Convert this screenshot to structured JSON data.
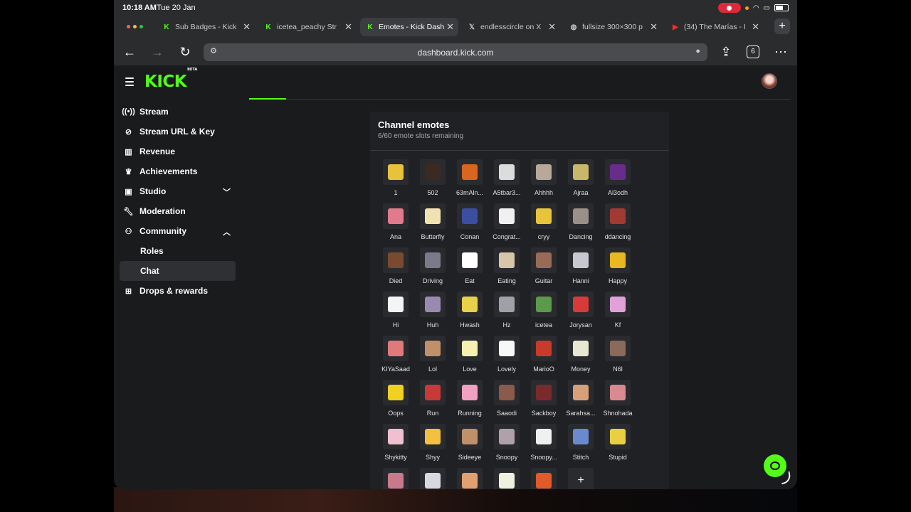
{
  "status": {
    "time": "10:18 AM",
    "date": "Tue 20 Jan"
  },
  "tabs": [
    {
      "label": "Sub Badges - Kick",
      "icon": "kick-icon"
    },
    {
      "label": "icetea_peachy Str",
      "icon": "kick-icon"
    },
    {
      "label": "Emotes - Kick Dash",
      "icon": "kick-icon",
      "active": true
    },
    {
      "label": "endlesscircle on X",
      "icon": "x-icon"
    },
    {
      "label": "fullsize 300×300 p",
      "icon": "globe-icon"
    },
    {
      "label": "(34) The Marías - I",
      "icon": "youtube-icon"
    }
  ],
  "browser": {
    "url": "dashboard.kick.com",
    "tab_count": "6"
  },
  "app": {
    "logo": "KICK",
    "logo_badge": "BETA"
  },
  "sidebar": [
    {
      "label": "Stream",
      "icon": "broadcast-icon"
    },
    {
      "label": "Stream URL & Key",
      "icon": "link-icon"
    },
    {
      "label": "Revenue",
      "icon": "chart-icon"
    },
    {
      "label": "Achievements",
      "icon": "trophy-icon"
    },
    {
      "label": "Studio",
      "icon": "studio-icon",
      "chevron": "down"
    },
    {
      "label": "Moderation",
      "icon": "wrench-icon"
    },
    {
      "label": "Community",
      "icon": "community-icon",
      "chevron": "up"
    },
    {
      "label": "Roles",
      "sub": true
    },
    {
      "label": "Chat",
      "sub": true,
      "active": true
    },
    {
      "label": "Drops & rewards",
      "icon": "drops-icon"
    }
  ],
  "panel": {
    "title": "Channel emotes",
    "subtitle": "6/60 emote slots remaining",
    "emotes": [
      {
        "name": "1",
        "color": "#e8c23a"
      },
      {
        "name": "502",
        "color": "#3b2a20"
      },
      {
        "name": "63mAln...",
        "color": "#d8661e"
      },
      {
        "name": "A5tbar3...",
        "color": "#dcdcdc"
      },
      {
        "name": "Ahhhh",
        "color": "#b8a89a"
      },
      {
        "name": "Ajraa",
        "color": "#c9b86a"
      },
      {
        "name": "Al3odh",
        "color": "#6a2c8a"
      },
      {
        "name": "Ana",
        "color": "#e07a8c"
      },
      {
        "name": "Butterfly",
        "color": "#f1e3b0"
      },
      {
        "name": "Conan",
        "color": "#3b4fa0"
      },
      {
        "name": "Congrat...",
        "color": "#f0f0f0"
      },
      {
        "name": "cryy",
        "color": "#e8c43a"
      },
      {
        "name": "Dancing",
        "color": "#9a9088"
      },
      {
        "name": "ddancing",
        "color": "#a23a34"
      },
      {
        "name": "Died",
        "color": "#7a4a30"
      },
      {
        "name": "Driving",
        "color": "#7a7a8a"
      },
      {
        "name": "Eat",
        "color": "#ffffff"
      },
      {
        "name": "Eating",
        "color": "#d8c6a8"
      },
      {
        "name": "Guitar",
        "color": "#9a6a58"
      },
      {
        "name": "Hanni",
        "color": "#c8c8d0"
      },
      {
        "name": "Happy",
        "color": "#e8b820"
      },
      {
        "name": "Hi",
        "color": "#f4f4f4"
      },
      {
        "name": "Huh",
        "color": "#9a8ab0"
      },
      {
        "name": "Hwash",
        "color": "#e8d04a"
      },
      {
        "name": "Hz",
        "color": "#a0a0a8"
      },
      {
        "name": "icetea",
        "color": "#5a9a4a"
      },
      {
        "name": "Jorysan",
        "color": "#d83a3a"
      },
      {
        "name": "Kf",
        "color": "#e0a0d8"
      },
      {
        "name": "KIYaSaad",
        "color": "#e07a7a"
      },
      {
        "name": "Lol",
        "color": "#c0906a"
      },
      {
        "name": "Love",
        "color": "#f8f0b0"
      },
      {
        "name": "Lovely",
        "color": "#f8f8f8"
      },
      {
        "name": "MarioO",
        "color": "#c83a2a"
      },
      {
        "name": "Money",
        "color": "#e8e8d0"
      },
      {
        "name": "N6l",
        "color": "#8a6a58"
      },
      {
        "name": "Oops",
        "color": "#f0d020"
      },
      {
        "name": "Run",
        "color": "#c83a3a"
      },
      {
        "name": "Running",
        "color": "#f0a0c0"
      },
      {
        "name": "Saaodi",
        "color": "#8a5a4a"
      },
      {
        "name": "Sackboy",
        "color": "#7a2a2a"
      },
      {
        "name": "Sarahsa...",
        "color": "#d8a078"
      },
      {
        "name": "Shnohada",
        "color": "#d88a90"
      },
      {
        "name": "Shykitty",
        "color": "#f0c0d0"
      },
      {
        "name": "Shyy",
        "color": "#f4c040"
      },
      {
        "name": "Sideeye",
        "color": "#c0906a"
      },
      {
        "name": "Snoopy",
        "color": "#b0a0a8"
      },
      {
        "name": "Snoopy...",
        "color": "#f0f0f0"
      },
      {
        "name": "Stitch",
        "color": "#6a8ad0"
      },
      {
        "name": "Stupid",
        "color": "#e8d040"
      },
      {
        "name": "",
        "color": "#c87a8a"
      },
      {
        "name": "",
        "color": "#d8d8e0"
      },
      {
        "name": "",
        "color": "#e0a070"
      },
      {
        "name": "",
        "color": "#f0f0e0"
      },
      {
        "name": "",
        "color": "#e05a2a"
      }
    ],
    "add_label": "+"
  }
}
